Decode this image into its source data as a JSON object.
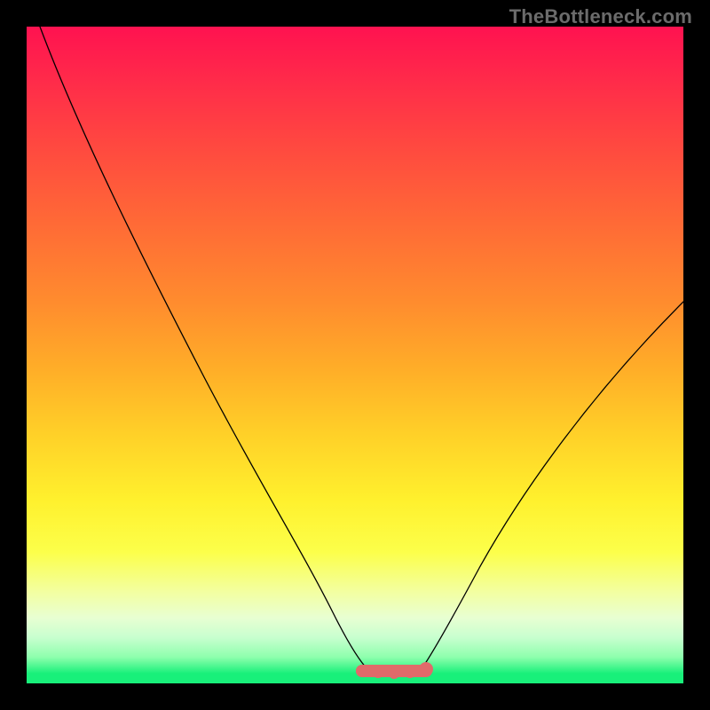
{
  "watermark": "TheBottleneck.com",
  "colors": {
    "curve": "#000000",
    "flat_segment": "#e06a6a",
    "gradient_top": "#ff1250",
    "gradient_bottom": "#18f07a",
    "frame": "#000000"
  },
  "chart_data": {
    "type": "line",
    "title": "",
    "xlabel": "",
    "ylabel": "",
    "xlim": [
      0,
      100
    ],
    "ylim": [
      0,
      100
    ],
    "series": [
      {
        "name": "left-curve",
        "x": [
          2,
          10,
          20,
          30,
          38,
          44,
          48,
          50,
          52
        ],
        "y": [
          100,
          84,
          64,
          44,
          28,
          16,
          8,
          4,
          2
        ]
      },
      {
        "name": "right-curve",
        "x": [
          60,
          62,
          66,
          72,
          80,
          90,
          100
        ],
        "y": [
          2,
          4,
          10,
          20,
          34,
          48,
          58
        ]
      },
      {
        "name": "flat-segment",
        "x": [
          51,
          60
        ],
        "y": [
          2,
          2
        ]
      }
    ],
    "annotations": [
      {
        "type": "highlight",
        "name": "bottleneck-flat-zone",
        "x_range": [
          51,
          60
        ],
        "y": 2
      }
    ]
  }
}
